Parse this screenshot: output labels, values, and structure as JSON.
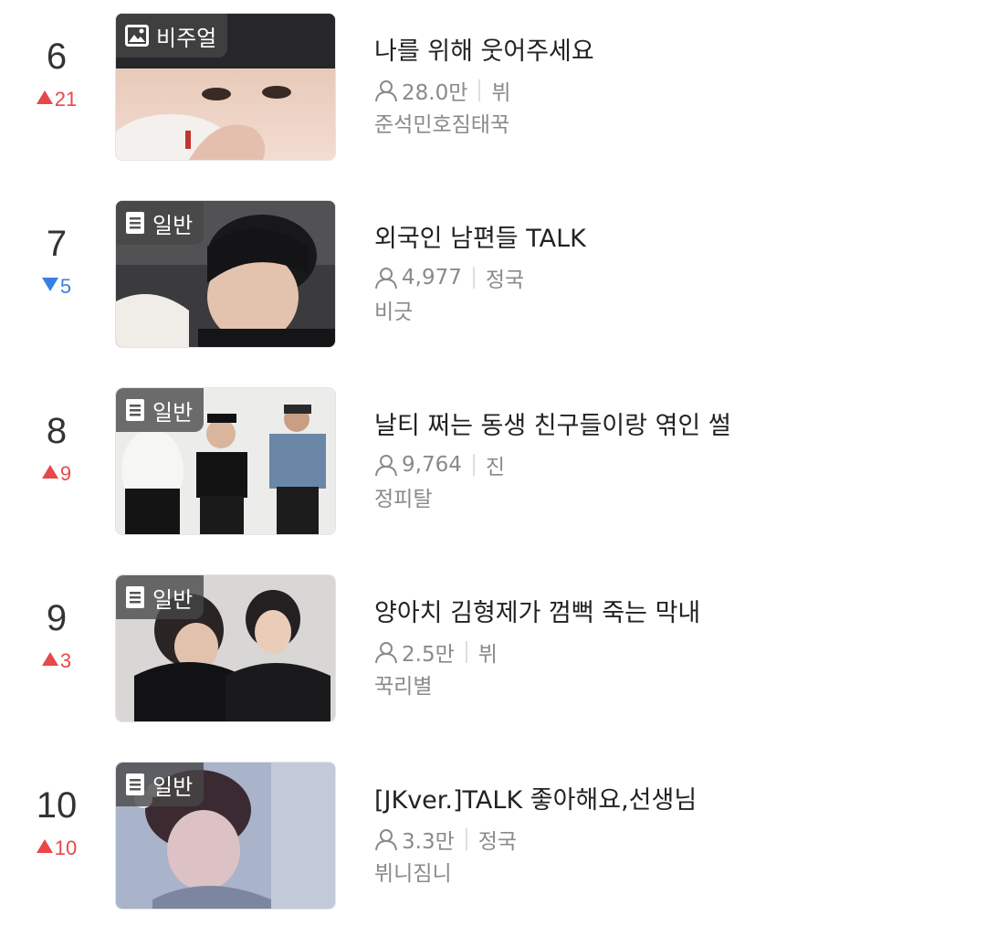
{
  "items": [
    {
      "rank": "6",
      "change": "21",
      "direction": "up",
      "badge": "비주얼",
      "badge_icon": "image-icon",
      "title": "나를 위해 웃어주세요",
      "views": "28.0만",
      "member": "뷔",
      "author": "준석민호짐태꾹"
    },
    {
      "rank": "7",
      "change": "5",
      "direction": "down",
      "badge": "일반",
      "badge_icon": "document-icon",
      "title": "외국인 남편들 TALK",
      "views": "4,977",
      "member": "정국",
      "author": "비긋"
    },
    {
      "rank": "8",
      "change": "9",
      "direction": "up",
      "badge": "일반",
      "badge_icon": "document-icon",
      "title": "날티 쩌는 동생 친구들이랑 엮인 썰",
      "views": "9,764",
      "member": "진",
      "author": "정피탈"
    },
    {
      "rank": "9",
      "change": "3",
      "direction": "up",
      "badge": "일반",
      "badge_icon": "document-icon",
      "title": "양아치 김형제가 껌뻑 죽는 막내",
      "views": "2.5만",
      "member": "뷔",
      "author": "꾹리별"
    },
    {
      "rank": "10",
      "change": "10",
      "direction": "up",
      "badge": "일반",
      "badge_icon": "document-icon",
      "title": "[JKver.]TALK 좋아해요,선생님",
      "views": "3.3만",
      "member": "정국",
      "author": "뷔니짐니"
    }
  ],
  "colors": {
    "rank_up": "#e8484a",
    "rank_down": "#3a7fe6",
    "badge_bg": "#464646",
    "meta_text": "#8a8a8a",
    "title_text": "#222222"
  }
}
